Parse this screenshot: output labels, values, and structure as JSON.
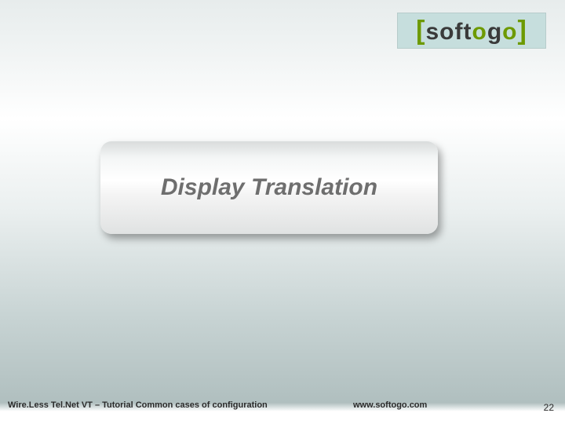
{
  "logo": {
    "bracket_open": "[",
    "part_soft": "soft",
    "part_o1": "o",
    "part_g": "g",
    "part_o2": "o",
    "bracket_close": "]"
  },
  "title_card": {
    "text": "Display Translation"
  },
  "footer": {
    "left": "Wire.Less Tel.Net VT – Tutorial Common cases of configuration",
    "center": "www.softogo.com",
    "page": "22"
  }
}
